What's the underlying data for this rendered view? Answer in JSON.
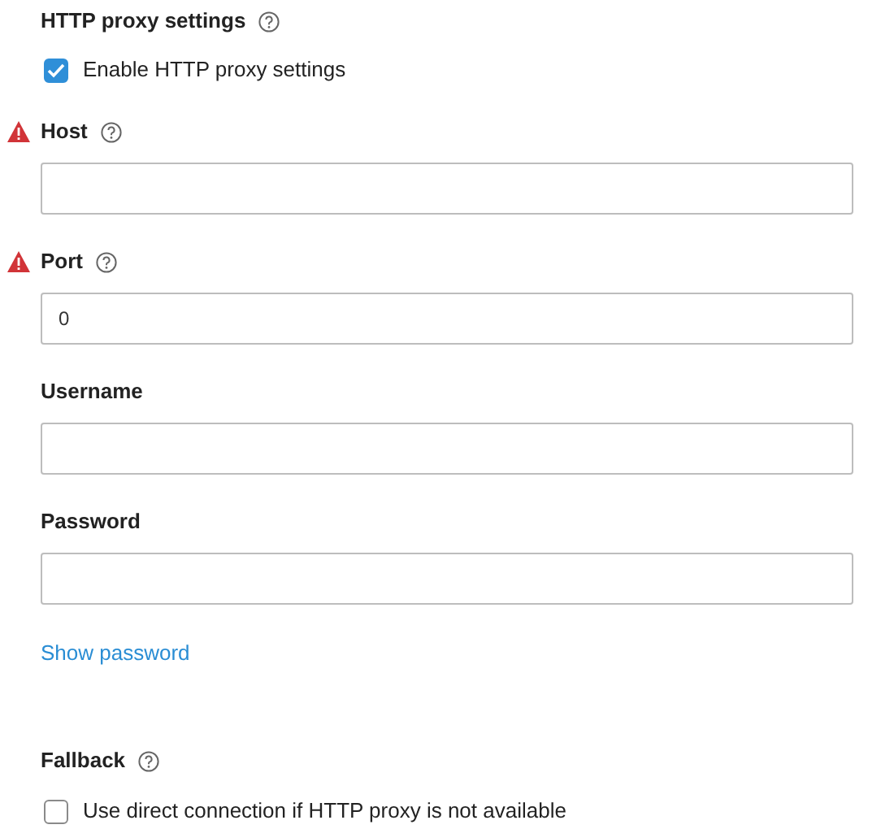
{
  "title": "HTTP proxy settings",
  "enable": {
    "label": "Enable HTTP proxy settings",
    "checked": true
  },
  "fields": [
    {
      "label": "Host",
      "warning": true,
      "help": true
    },
    {
      "label": "Port",
      "warning": true,
      "help": true,
      "value": "0"
    },
    {
      "label": "Username",
      "warning": false,
      "help": false
    },
    {
      "label": "Password",
      "warning": false,
      "help": false
    }
  ],
  "show_password": "Show password",
  "fallback": {
    "title": "Fallback",
    "label": "Use direct connection if HTTP proxy is not available",
    "checked": false
  }
}
